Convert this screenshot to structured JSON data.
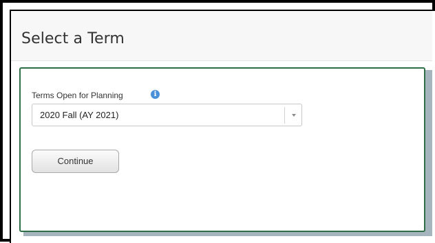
{
  "header": {
    "title": "Select a Term"
  },
  "form": {
    "field_label": "Terms Open for Planning",
    "info_icon": "info-icon",
    "term_select": {
      "selected_value": "2020 Fall (AY 2021)",
      "arrow_icon": "chevron-down-icon"
    },
    "continue_label": "Continue"
  },
  "colors": {
    "panel_border": "#2d6e46",
    "content_band": "#a6b4be",
    "info_icon": "#4a90d9"
  }
}
